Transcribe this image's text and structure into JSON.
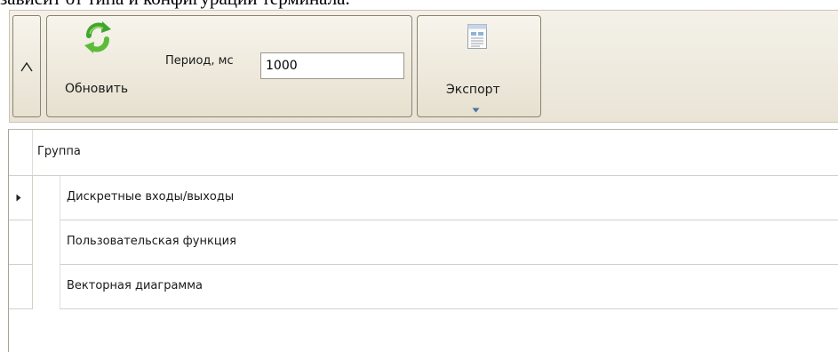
{
  "document": {
    "fragment_text": "зависит от типа и конфигурации терминала."
  },
  "toolbar": {
    "collapse_button": {
      "icon": "chevron-up-icon"
    },
    "refresh": {
      "label": "Обновить",
      "icon": "refresh-icon",
      "icon_colors": [
        "#3fa62e",
        "#8dd14a"
      ]
    },
    "period": {
      "label": "Период, мс",
      "value": "1000"
    },
    "export": {
      "label": "Экспорт",
      "icon": "report-document-icon"
    }
  },
  "grid": {
    "header": {
      "column_label": "Группа"
    },
    "current_row_index": 0,
    "rows": [
      {
        "label": "Дискретные входы/выходы"
      },
      {
        "label": "Пользовательская функция"
      },
      {
        "label": "Векторная диаграмма"
      }
    ]
  },
  "colors": {
    "toolbar_background": "#ede8da",
    "panel_border": "#8a8372",
    "grid_line": "#d4d0c8"
  }
}
